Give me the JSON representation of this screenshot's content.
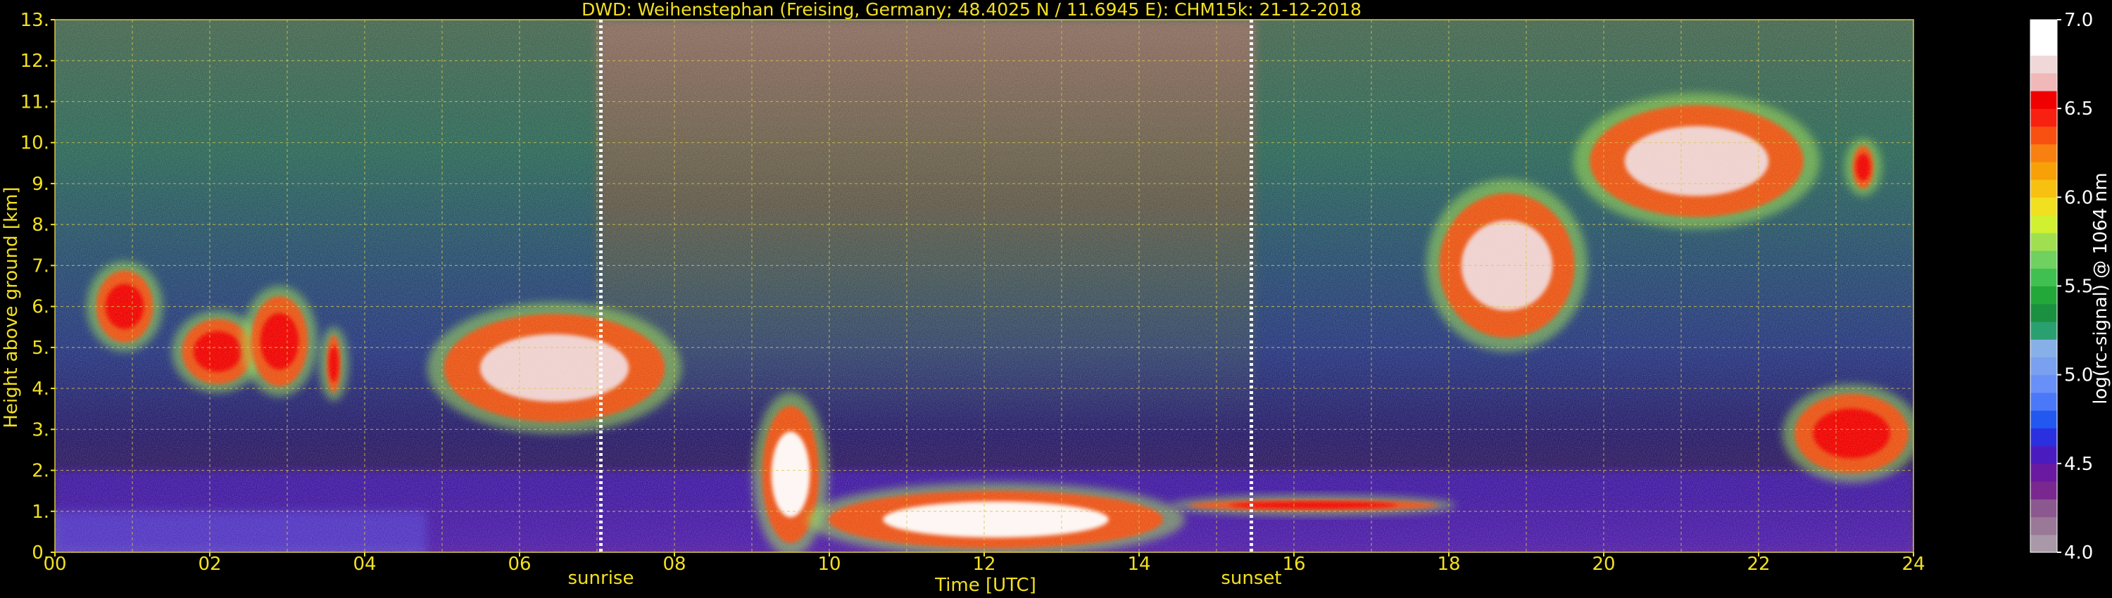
{
  "chart_data": {
    "type": "heatmap",
    "title": "DWD: Weihenstephan (Freising, Germany; 48.4025 N / 11.6945 E):    CHM15k: 21-12-2018",
    "xlabel": "Time [UTC]",
    "ylabel": "Height above ground [km]",
    "xlim": [
      0,
      24
    ],
    "ylim": [
      0,
      13
    ],
    "x_ticks": [
      "00",
      "02",
      "04",
      "06",
      "08",
      "10",
      "12",
      "14",
      "16",
      "18",
      "20",
      "22",
      "24"
    ],
    "y_ticks": [
      "0.",
      "1.",
      "2.",
      "3.",
      "4.",
      "5.",
      "6.",
      "7.",
      "8.",
      "9.",
      "10.",
      "11.",
      "12.",
      "13."
    ],
    "grid": true,
    "markers": [
      {
        "label": "sunrise",
        "time": 7.05
      },
      {
        "label": "sunset",
        "time": 15.45
      }
    ],
    "colorbar": {
      "label": "log(rc-signal) @ 1064 nm",
      "range": [
        4.0,
        7.0
      ],
      "ticks": [
        "4.0",
        "4.5",
        "5.0",
        "5.5",
        "6.0",
        "6.5",
        "7.0"
      ],
      "colors": [
        "#a898a8",
        "#9a7898",
        "#8c5890",
        "#7a2890",
        "#6a1aa0",
        "#4a1cc0",
        "#2a30e0",
        "#2258f0",
        "#4a78f8",
        "#6890f8",
        "#7aa0f0",
        "#88b0e8",
        "#2aa070",
        "#1a9040",
        "#22a838",
        "#40c050",
        "#70d060",
        "#a0e050",
        "#d0f030",
        "#f0e020",
        "#f8c010",
        "#f8a008",
        "#f88010",
        "#f85010",
        "#f82010",
        "#f00000",
        "#f0b8b8",
        "#f0d8d8",
        "#ffffff",
        "#ffffff"
      ]
    },
    "features": [
      {
        "name": "boundary layer (blue)",
        "x": [
          0,
          4.8
        ],
        "height_km": [
          0,
          1.0
        ],
        "level": 5.0
      },
      {
        "name": "aerosol layer (purple)",
        "x": [
          0,
          24
        ],
        "height_km": [
          0,
          2.0
        ],
        "level": 4.6
      },
      {
        "name": "mid-level cloud",
        "x": [
          0.5,
          1.3
        ],
        "height_km": [
          5.0,
          7.0
        ],
        "level": 6.6
      },
      {
        "name": "mid-level cloud",
        "x": [
          1.6,
          2.6
        ],
        "height_km": [
          4.0,
          5.8
        ],
        "level": 6.6
      },
      {
        "name": "mid-level cloud",
        "x": [
          2.5,
          3.3
        ],
        "height_km": [
          3.9,
          6.4
        ],
        "level": 6.6
      },
      {
        "name": "mid-level cloud",
        "x": [
          3.5,
          3.7
        ],
        "height_km": [
          3.8,
          5.4
        ],
        "level": 6.5
      },
      {
        "name": "mid-level cloud",
        "x": [
          4.9,
          8.0
        ],
        "height_km": [
          3.0,
          6.0
        ],
        "level": 6.8
      },
      {
        "name": "low cloud",
        "x": [
          9.1,
          9.9
        ],
        "height_km": [
          0.0,
          3.8
        ],
        "level": 6.9
      },
      {
        "name": "low cloud / fog",
        "x": [
          9.8,
          14.5
        ],
        "height_km": [
          0.0,
          1.6
        ],
        "level": 6.9
      },
      {
        "name": "low cloud top",
        "x": [
          14.5,
          18.0
        ],
        "height_km": [
          1.0,
          1.3
        ],
        "level": 6.6
      },
      {
        "name": "cirrus",
        "x": [
          17.8,
          19.7
        ],
        "height_km": [
          5.0,
          9.0
        ],
        "level": 6.7
      },
      {
        "name": "cirrus",
        "x": [
          19.7,
          22.7
        ],
        "height_km": [
          8.0,
          11.1
        ],
        "level": 6.7
      },
      {
        "name": "cirrus",
        "x": [
          23.2,
          23.5
        ],
        "height_km": [
          8.8,
          10.0
        ],
        "level": 6.5
      },
      {
        "name": "low cloud",
        "x": [
          22.4,
          24.0
        ],
        "height_km": [
          1.8,
          4.0
        ],
        "level": 6.6
      }
    ]
  }
}
